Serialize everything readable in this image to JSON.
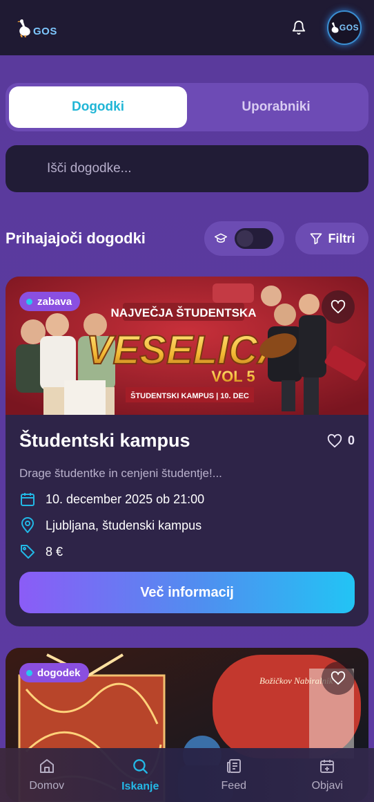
{
  "header": {
    "logo_text": "GOS",
    "avatar_text": "GOS"
  },
  "tabs": [
    {
      "label": "Dogodki",
      "active": true
    },
    {
      "label": "Uporabniki",
      "active": false
    }
  ],
  "search": {
    "placeholder": "Išči dogodke..."
  },
  "section": {
    "title": "Prihajajoči dogodki",
    "filter_label": "Filtri"
  },
  "events": [
    {
      "tag": "zabava",
      "poster": {
        "headline_top": "NAJVEČJA ŠTUDENTSKA",
        "headline_main": "VESELICA",
        "headline_vol": "VOL 5",
        "footer": "ŠTUDENTSKI KAMPUS | 10. DEC"
      },
      "title": "Študentski kampus",
      "likes": "0",
      "description": "Drage študentke in cenjeni študentje!...",
      "date": "10. december 2025 ob 21:00",
      "location": "Ljubljana, študenski kampus",
      "price": "8 €",
      "cta": "Več informacij"
    },
    {
      "tag": "dogodek",
      "poster": {
        "sign_text": "Božičkov Nabiralnik"
      }
    }
  ],
  "bottom_nav": [
    {
      "label": "Domov",
      "icon": "home-icon"
    },
    {
      "label": "Iskanje",
      "icon": "search-icon",
      "active": true
    },
    {
      "label": "Feed",
      "icon": "feed-icon"
    },
    {
      "label": "Objavi",
      "icon": "calendar-plus-icon"
    }
  ],
  "colors": {
    "accent": "#22b8e6",
    "background": "#5b3aa0",
    "card": "#2e2448",
    "topbar": "#1f1a33"
  }
}
